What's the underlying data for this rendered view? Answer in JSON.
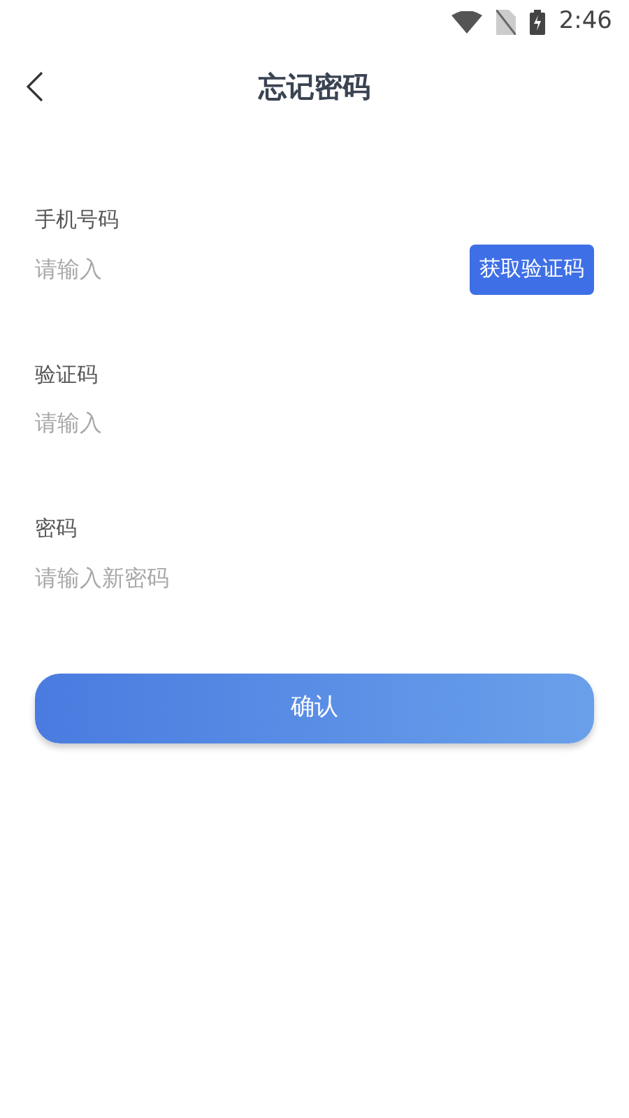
{
  "status_bar": {
    "time": "2:46"
  },
  "header": {
    "title": "忘记密码"
  },
  "fields": [
    {
      "label": "手机号码",
      "placeholder": "请输入",
      "action": "获取验证码"
    },
    {
      "label": "验证码",
      "placeholder": "请输入"
    },
    {
      "label": "密码",
      "placeholder": "请输入新密码"
    }
  ],
  "submit": {
    "label": "确认"
  }
}
